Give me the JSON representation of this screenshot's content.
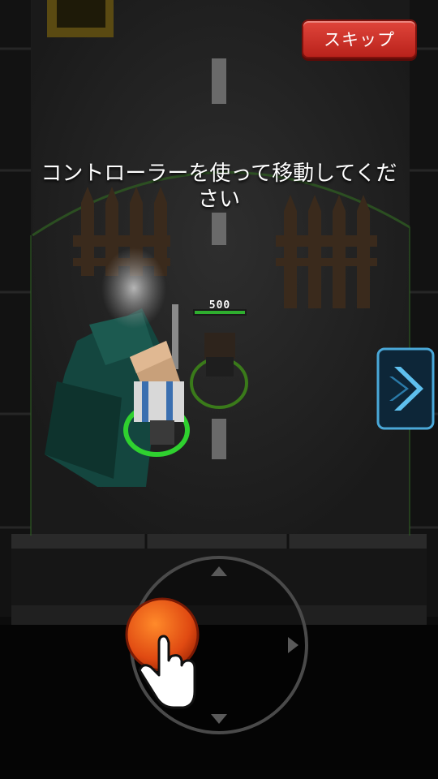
{
  "hud": {
    "skip_label": "スキップ"
  },
  "tutorial": {
    "instruction": "コントローラーを使って移動してください"
  },
  "enemy": {
    "hp_value": "500"
  },
  "icons": {
    "next": "chevron-right-icon",
    "pointer": "hand-pointer-icon",
    "dpad_up": "triangle-up-icon",
    "dpad_down": "triangle-down-icon",
    "dpad_right": "triangle-right-icon"
  },
  "colors": {
    "skip_button": "#d8372e",
    "joystick_knob": "#e8501a",
    "selection_ring": "#2fd12f",
    "enemy_ring": "#3a7a1a",
    "next_arrow": "#4aa8d8"
  }
}
